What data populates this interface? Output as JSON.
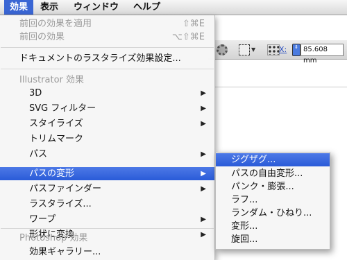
{
  "menubar": {
    "items": [
      {
        "label": "効果"
      },
      {
        "label": "表示"
      },
      {
        "label": "ウィンドウ"
      },
      {
        "label": "ヘルプ"
      }
    ]
  },
  "control_bar": {
    "x_label": "X:",
    "x_value": "85.608 mm",
    "stepper_glyph": "⇕"
  },
  "menu": {
    "apply_last": {
      "label": "前回の効果を適用",
      "shortcut": "⇧⌘E"
    },
    "last_effect": {
      "label": "前回の効果",
      "shortcut": "⌥⇧⌘E"
    },
    "raster_settings": {
      "label": "ドキュメントのラスタライズ効果設定..."
    },
    "illustrator_header": "Illustrator 効果",
    "illustrator_items": [
      {
        "label": "3D",
        "submenu": true
      },
      {
        "label": "SVG フィルター",
        "submenu": true
      },
      {
        "label": "スタイライズ",
        "submenu": true
      },
      {
        "label": "トリムマーク",
        "submenu": false
      },
      {
        "label": "パス",
        "submenu": true
      },
      {
        "label": "パスの変形",
        "submenu": true
      },
      {
        "label": "パスファインダー",
        "submenu": true
      },
      {
        "label": "ラスタライズ...",
        "submenu": false
      },
      {
        "label": "ワープ",
        "submenu": true
      },
      {
        "label": "形状に変換",
        "submenu": true
      }
    ],
    "photoshop_header": "Photoshop 効果",
    "photoshop_items": [
      {
        "label": "効果ギャラリー..."
      }
    ],
    "arrow_glyph": "▶"
  },
  "submenu": {
    "items": [
      {
        "label": "ジグザグ..."
      },
      {
        "label": "パスの自由変形..."
      },
      {
        "label": "パンク・膨張..."
      },
      {
        "label": "ラフ..."
      },
      {
        "label": "ランダム・ひねり..."
      },
      {
        "label": "変形..."
      },
      {
        "label": "旋回..."
      }
    ]
  },
  "colors": {
    "highlight": "#2f5fd9",
    "disabled_text": "#9a9a9a"
  }
}
